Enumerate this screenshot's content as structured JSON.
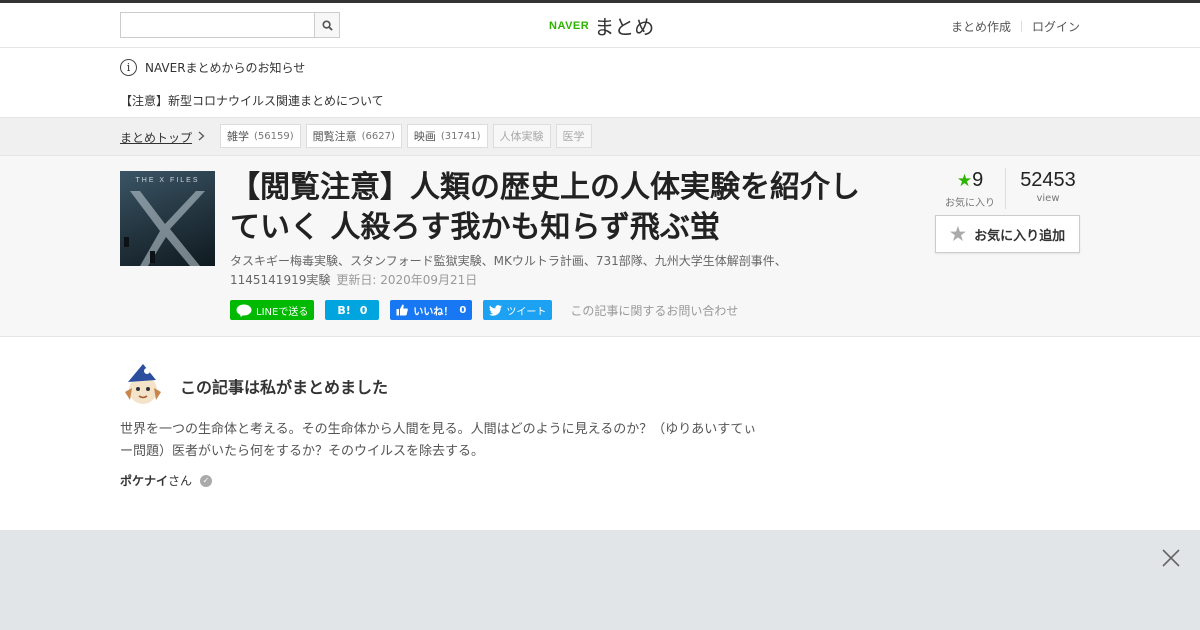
{
  "header": {
    "search_placeholder": "",
    "logo_naver": "NAVER",
    "logo_matome": "まとめ",
    "links": [
      "まとめ作成",
      "ログイン"
    ]
  },
  "notice": {
    "heading": "NAVERまとめからのお知らせ",
    "link": "【注意】新型コロナウイルス関連まとめについて"
  },
  "breadcrumb": {
    "top": "まとめトップ",
    "tags": [
      {
        "label": "雑学",
        "count": "(56159)"
      },
      {
        "label": "閲覧注意",
        "count": "(6627)"
      },
      {
        "label": "映画",
        "count": "(31741)"
      },
      {
        "label": "人体実験",
        "count": ""
      },
      {
        "label": "医学",
        "count": ""
      }
    ]
  },
  "article": {
    "thumb_text": "THE X FILES",
    "title": "【閲覧注意】人類の歴史上の人体実験を紹介していく 人殺ろす我かも知らず飛ぶ蛍",
    "keywords": "タスキギー梅毒実験、スタンフォード監獄実験、MKウルトラ計画、731部隊、九州大学生体解剖事件、1145141919実験",
    "updated": "更新日: 2020年09月21日",
    "shares": {
      "line": "LINEで送る",
      "hatena_icon": "B!",
      "hatena_count": "0",
      "fb_label": "いいね！",
      "fb_count": "0",
      "tweet": "ツイート"
    },
    "inquiry": "この記事に関するお問い合わせ",
    "favorites": "9",
    "favorites_label": "お気に入り",
    "views": "52453",
    "views_label": "view",
    "fav_button": "お気に入り追加"
  },
  "author": {
    "heading": "この記事は私がまとめました",
    "description": "世界を一つの生命体と考える。その生命体から人間を見る。人間はどのように見えるのか？（ゆりあいすてぃー問題）医者がいたら何をするか？そのウイルスを除去する。",
    "name": "ポケナイ",
    "suffix": "さん"
  },
  "colors": {
    "naver_green": "#2db400",
    "line_green": "#00b900",
    "hatena_blue": "#00a4de",
    "facebook_blue": "#1877f2",
    "twitter_blue": "#1da1f2"
  }
}
